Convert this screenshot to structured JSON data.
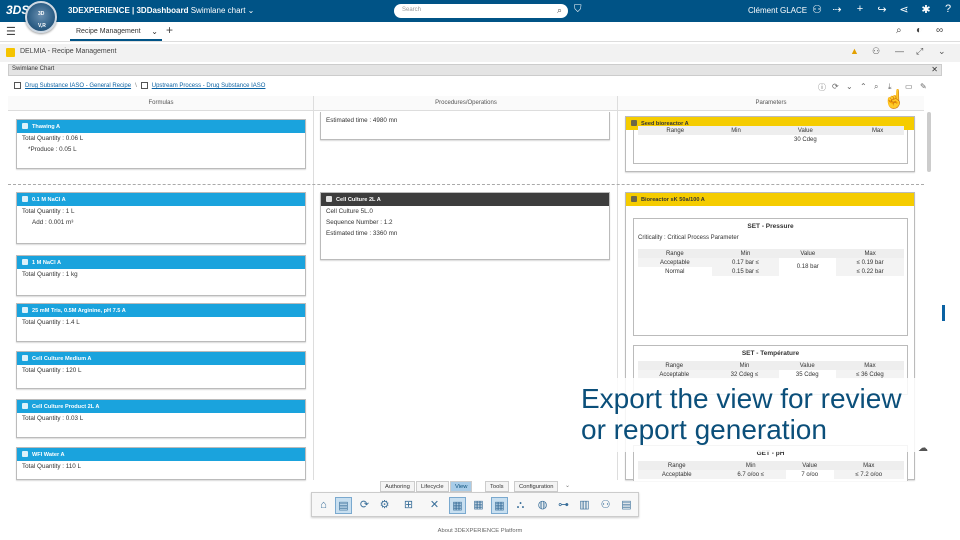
{
  "topbar": {
    "logo": "3DS",
    "brand_strong": "3DEXPERIENCE | 3DDashboard",
    "brand_rest": " Swimlane chart",
    "compass_top": "3D",
    "compass_bottom": "V,R",
    "search_placeholder": "Search",
    "user": "Clément GLACE"
  },
  "tabs": {
    "active": "Recipe Management"
  },
  "app": {
    "title": "DELMIA - Recipe Management"
  },
  "widget": {
    "title": "Swimlane Chart"
  },
  "breadcrumb": {
    "item1": "Drug Substance IASO - General Recipe",
    "separator": "\\",
    "item2": "Upstream Process - Drug Substance IASO"
  },
  "columns": {
    "formulas": "Formulas",
    "procedures": "Procedures/Operations",
    "parameters": "Parameters"
  },
  "formulas": [
    {
      "title": "Thawing A",
      "lines": [
        "Total Quantity : 0.06 L",
        "*Produce : 0.05 L"
      ]
    },
    {
      "title": "0.1 M NaCl A",
      "lines": [
        "Total Quantity : 1 L",
        "Add : 0.001 m³"
      ]
    },
    {
      "title": "1 M NaCl A",
      "lines": [
        "Total Quantity : 1 kg"
      ]
    },
    {
      "title": "25 mM Tris, 0.5M Arginine, pH 7.5 A",
      "lines": [
        "Total Quantity : 1.4 L"
      ]
    },
    {
      "title": "Cell Culture Medium A",
      "lines": [
        "Total Quantity : 120 L"
      ]
    },
    {
      "title": "Cell Culture Product 2L A",
      "lines": [
        "Total Quantity : 0.03 L"
      ]
    },
    {
      "title": "WFI Water A",
      "lines": [
        "Total Quantity : 110 L"
      ]
    }
  ],
  "procedures": {
    "top_estimated": "Estimated time : 4980 mn",
    "cell_culture": {
      "title": "Cell Culture 2L A",
      "line1": "Cell Culture 5L.0",
      "line2": "Sequence Number : 1.2",
      "line3": "Estimated time : 3360 mn"
    }
  },
  "parameters": {
    "seed": {
      "title": "Seed bioreactor A",
      "head": [
        "Range",
        "Min",
        "Value",
        "Max"
      ],
      "value": "30 Cdeg"
    },
    "bioreactor": {
      "title": "Bioreactor sK 50a/100 A",
      "pressure": {
        "title": "SET - Pressure",
        "criticality": "Criticality : Critical Process Parameter",
        "head": [
          "Range",
          "Min",
          "Value",
          "Max"
        ],
        "row1": [
          "Acceptable",
          "0.17 bar ≤",
          "≤ 0.19 bar"
        ],
        "row2": [
          "Normal",
          "0.15 bar ≤",
          "≤ 0.22 bar"
        ],
        "value": "0.18 bar"
      },
      "temperature": {
        "title": "SET - Température",
        "head": [
          "Range",
          "Min",
          "Value",
          "Max"
        ],
        "row1": [
          "Acceptable",
          "32 Cdeg ≤",
          "≤ 36 Cdeg"
        ],
        "value": "35 Cdeg"
      },
      "ph": {
        "title": "GET - pH",
        "head": [
          "Range",
          "Min",
          "Value",
          "Max"
        ],
        "row1": [
          "Acceptable",
          "6.7 o/oo ≤",
          "≤ 7.2 o/oo"
        ],
        "value": "7 o/oo"
      }
    }
  },
  "overlay": {
    "line1": "Export the view for review",
    "line2": "or report generation"
  },
  "bottom_tabs": [
    "Authoring",
    "Lifecycle",
    "View",
    "Tools",
    "Configuration"
  ],
  "footer": "About 3DEXPERIENCE Platform"
}
